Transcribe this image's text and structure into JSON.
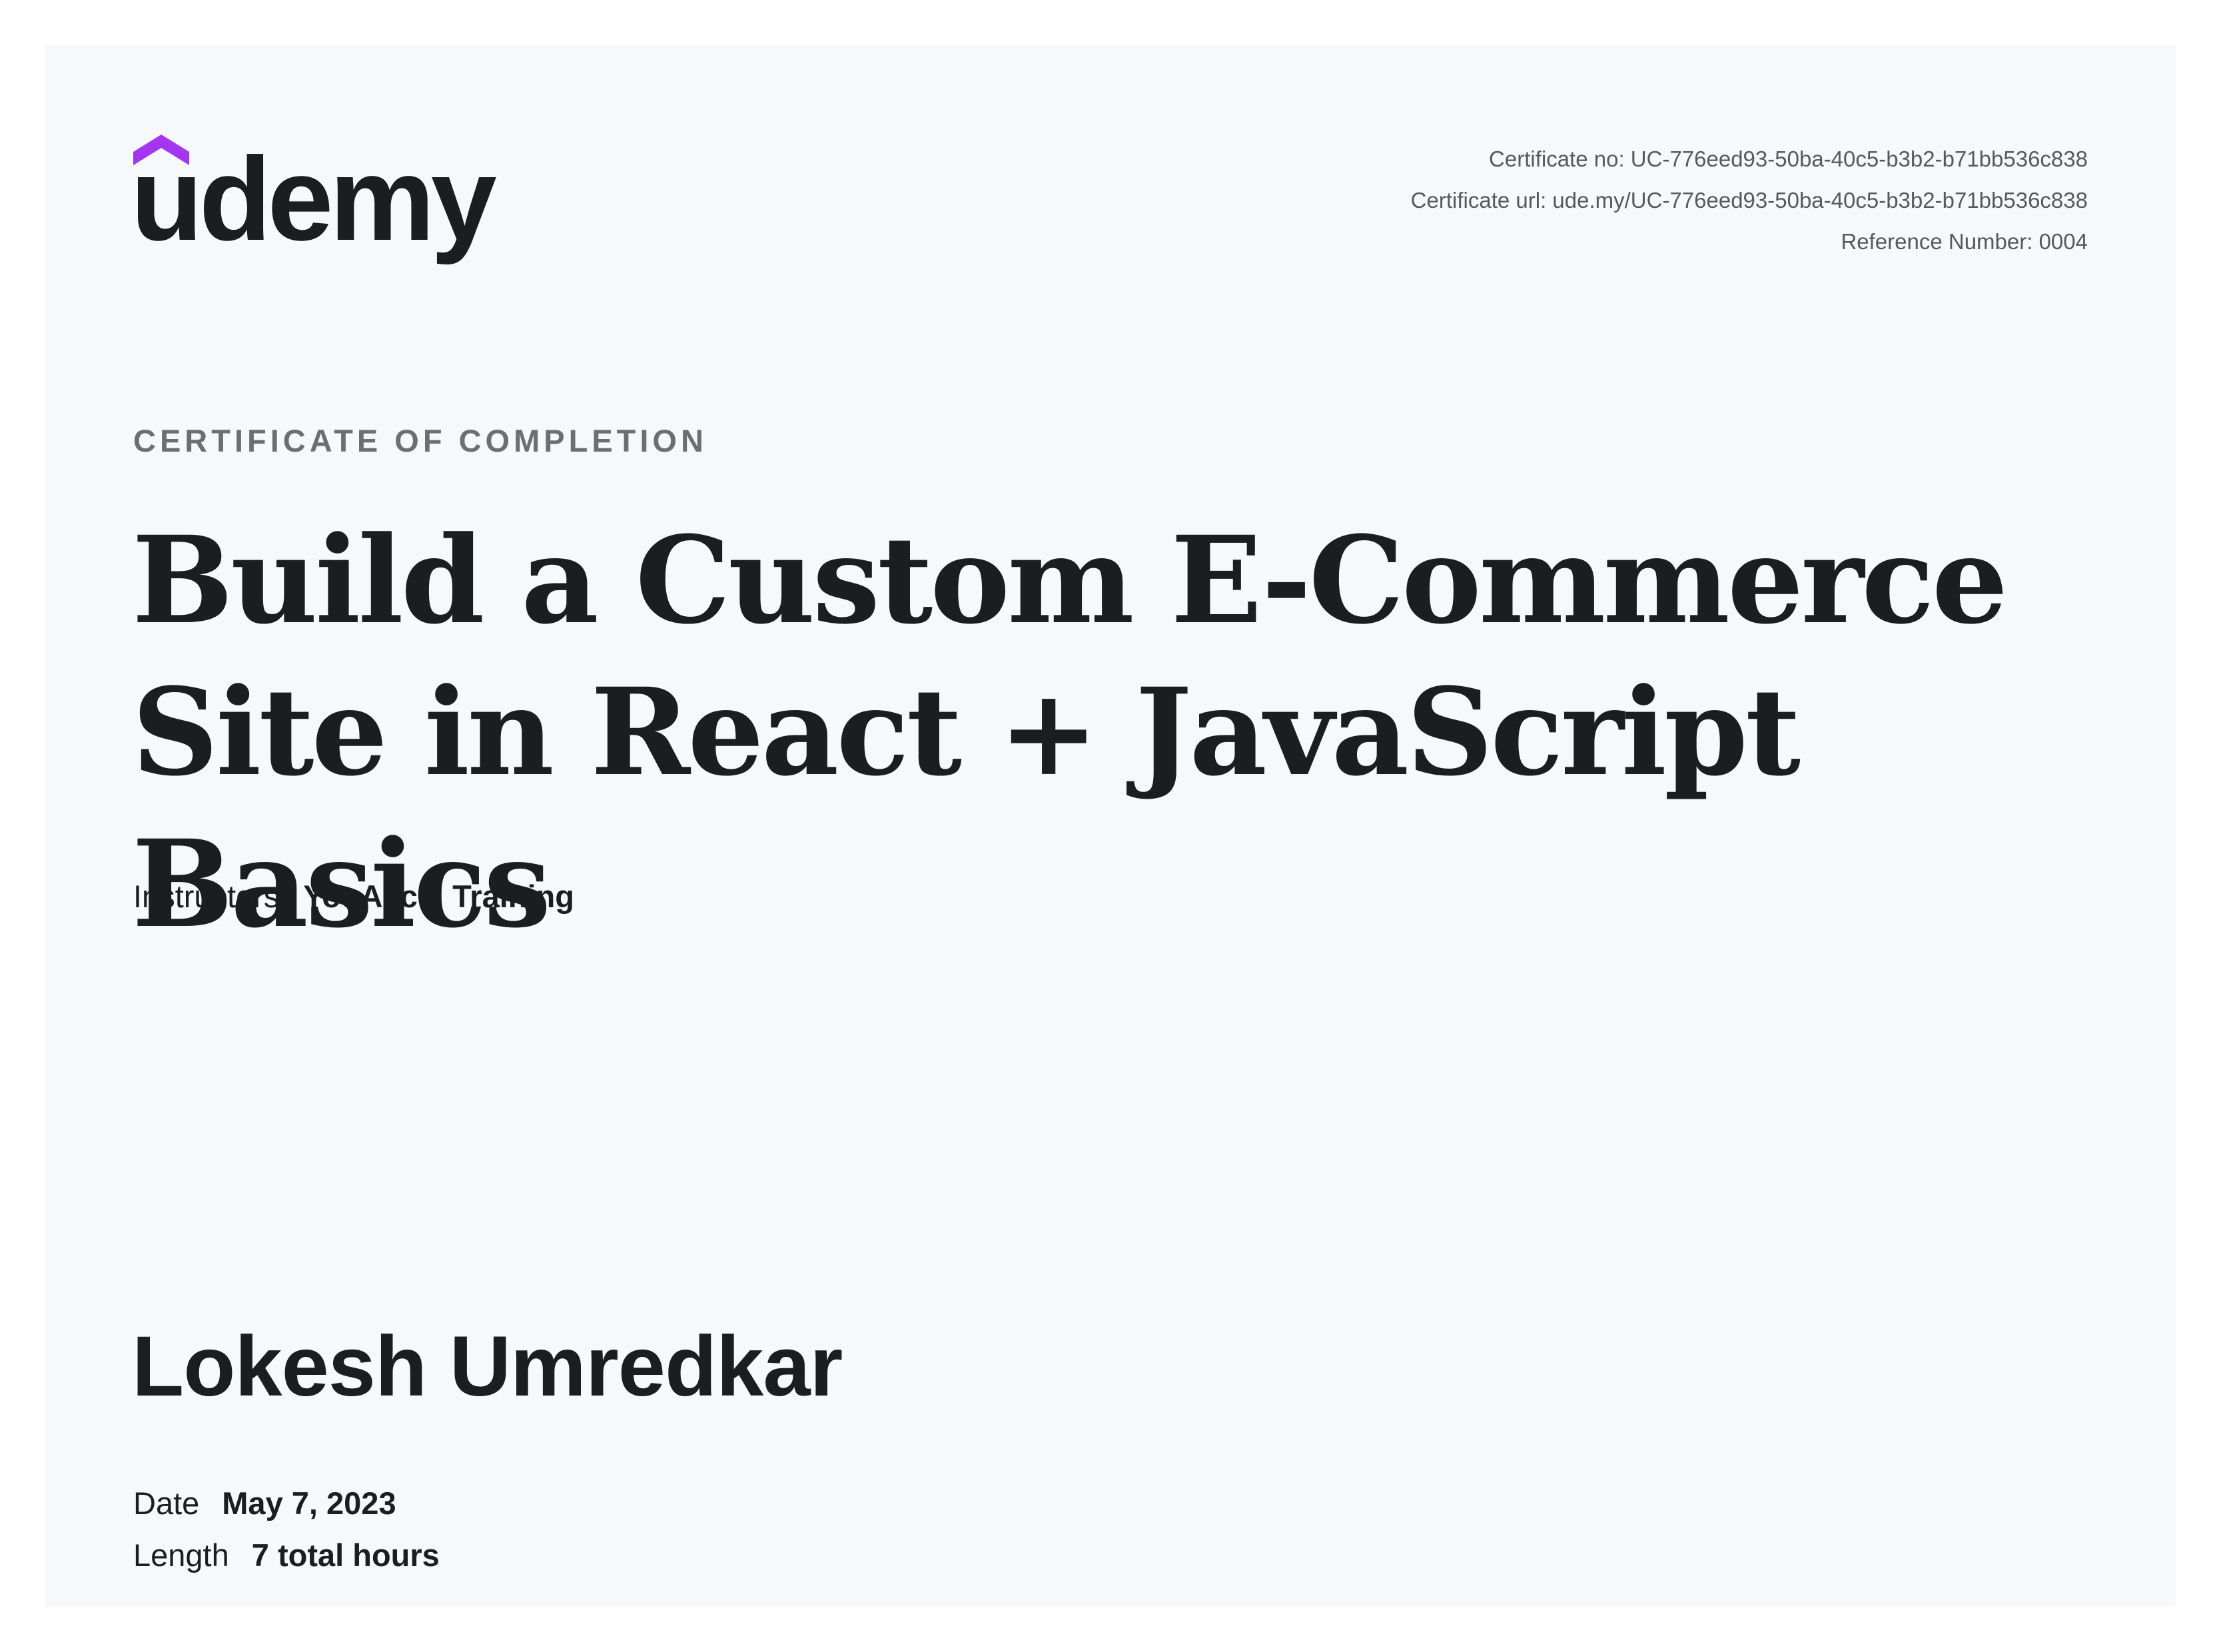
{
  "brand": {
    "name": "udemy",
    "accent_color": "#a435f0",
    "text_color": "#1c1d1f"
  },
  "certificate": {
    "number_line": "Certificate no: UC-776eed93-50ba-40c5-b3b2-b71bb536c838",
    "url_line": "Certificate url: ude.my/UC-776eed93-50ba-40c5-b3b2-b71bb536c838",
    "reference_line": "Reference Number: 0004"
  },
  "eyebrow": "CERTIFICATE OF COMPLETION",
  "course": {
    "title_line1": "Build a Custom E-Commerce",
    "title_line2": "Site in React + JavaScript Basics"
  },
  "instructors": {
    "label": "Instructors",
    "value": "YouAccel Training"
  },
  "student": {
    "name": "Lokesh Umredkar"
  },
  "details": {
    "date_label": "Date",
    "date_value": "May 7, 2023",
    "length_label": "Length",
    "length_value": "7 total hours"
  }
}
